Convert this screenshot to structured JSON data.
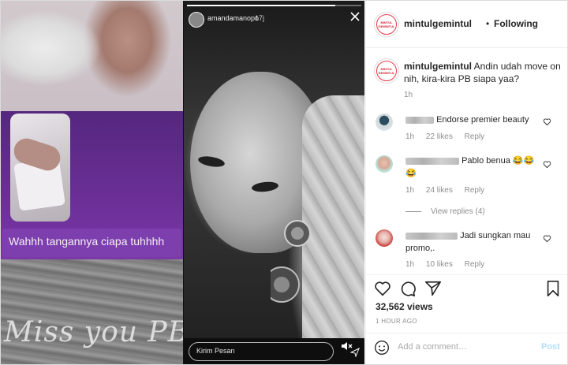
{
  "media": {
    "left_caption": "Wahhh tangannya ciapa tuhhhh",
    "left_watermark": "Miss you PB",
    "story": {
      "username": "amandamanopo",
      "time": "17j",
      "message_placeholder": "Kirim Pesan",
      "progress": 0.85
    }
  },
  "header": {
    "logo_text": "MINTUL GEMINTUL",
    "username": "mintulgemintul",
    "dot": "•",
    "follow_state": "Following"
  },
  "caption": {
    "username": "mintulgemintul",
    "text": "Andin udah move on nih, kira-kira PB siapa yaa?",
    "time": "1h"
  },
  "comments": [
    {
      "text": "Endorse premier beauty",
      "time": "1h",
      "likes": "22 likes",
      "reply": "Reply"
    },
    {
      "text": "Pablo benua 😂😂 😂",
      "time": "1h",
      "likes": "24 likes",
      "reply": "Reply"
    },
    {
      "text": "Jadi sungkan mau promo,.",
      "time": "1h",
      "likes": "10 likes",
      "reply": "Reply"
    }
  ],
  "view_replies": "View replies (4)",
  "stats": {
    "views": "32,562 views",
    "posted": "1 HOUR AGO"
  },
  "composer": {
    "placeholder": "Add a comment…",
    "post_label": "Post"
  },
  "colors": {
    "text": "#262626",
    "muted": "#8e8e8e",
    "post_disabled": "#b2dffc",
    "border": "#efefef",
    "purple": "#6b2f97"
  }
}
